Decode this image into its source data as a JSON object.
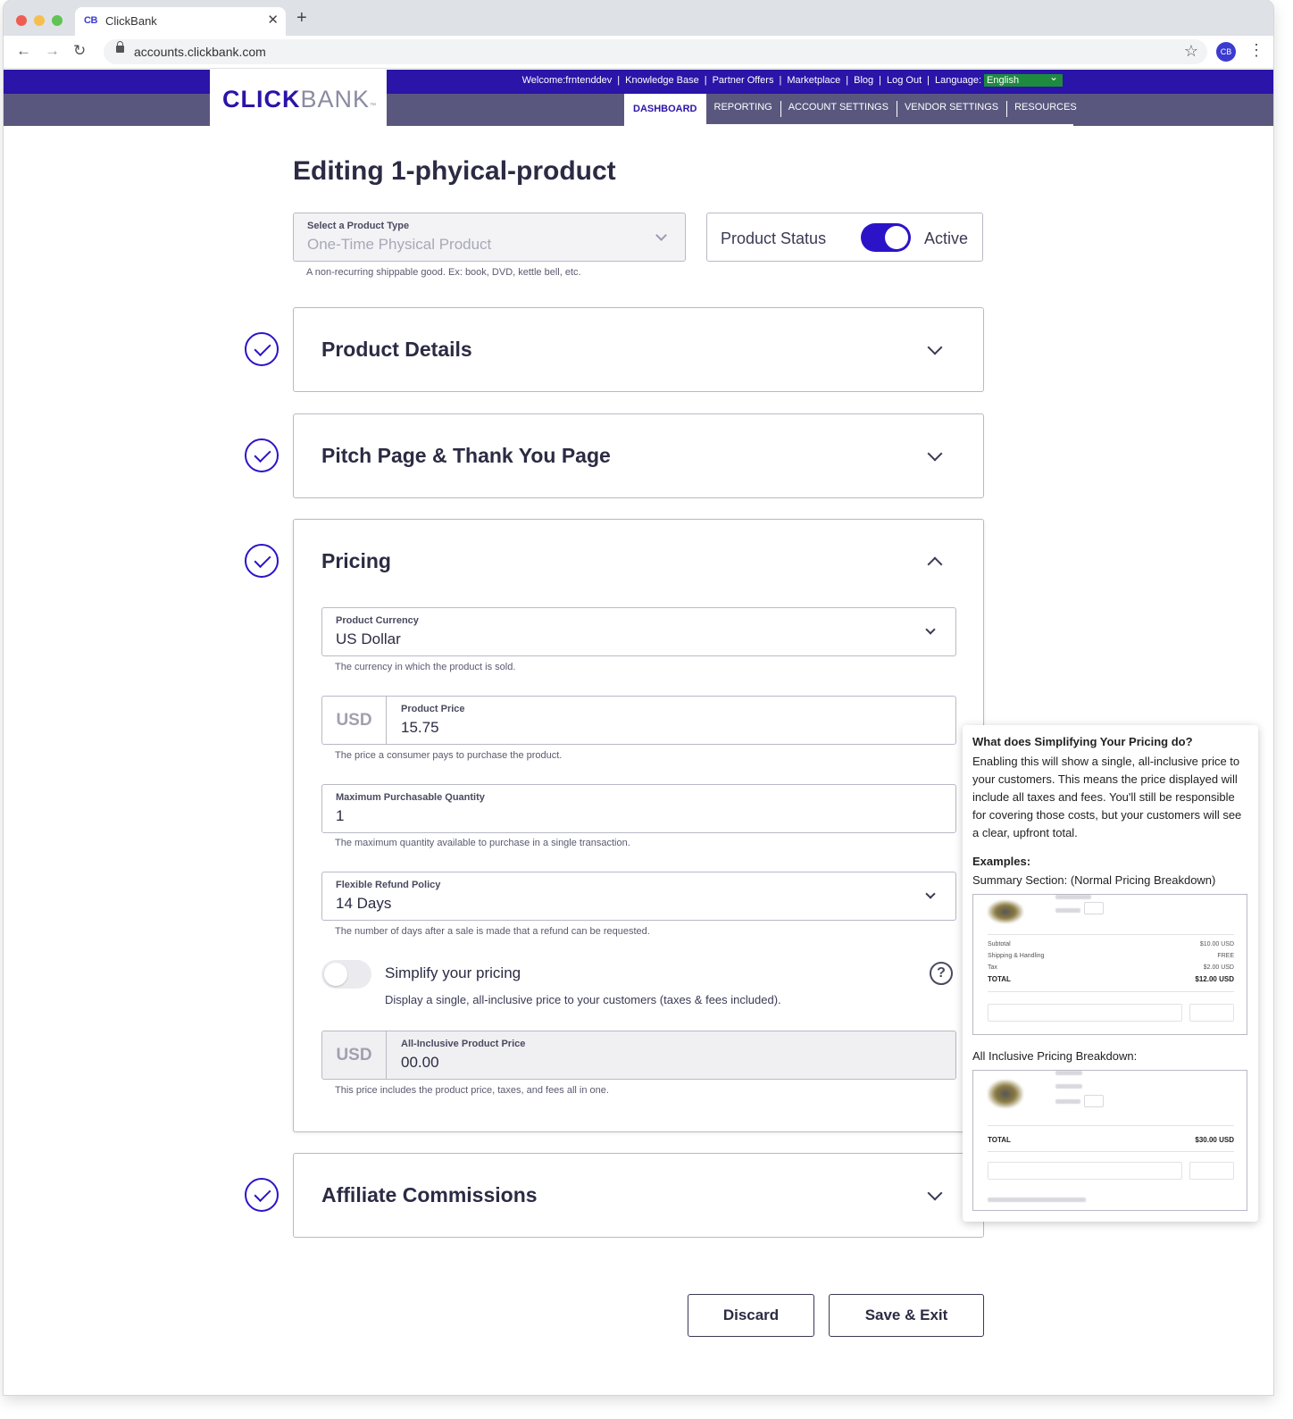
{
  "browser": {
    "tab_title": "ClickBank",
    "tab_favicon": "CB",
    "tab_close": "✕",
    "new_tab": "+",
    "url": "accounts.clickbank.com",
    "profile_initials": "CB",
    "icons": {
      "back": "←",
      "forward": "→",
      "reload": "↻",
      "bookmark": "☆",
      "menu": "⋮"
    }
  },
  "header": {
    "logo_click": "CLICK",
    "logo_bank": "BANK",
    "logo_tm": "™",
    "welcome": "Welcome:frntenddev",
    "links": [
      "Knowledge Base",
      "Partner Offers",
      "Marketplace",
      "Blog",
      "Log Out"
    ],
    "separator": "|",
    "language_label": "Language:",
    "language_value": "English",
    "nav": [
      "DASHBOARD",
      "REPORTING",
      "ACCOUNT SETTINGS",
      "VENDOR SETTINGS",
      "RESOURCES"
    ],
    "colors": {
      "topbar": "#2b14a8",
      "subbar": "#5a577f",
      "language": "#1e8a3e"
    }
  },
  "page": {
    "title": "Editing 1-phyical-product",
    "product_type": {
      "label": "Select a Product Type",
      "value": "One-Time Physical Product",
      "helper": "A non-recurring shippable good. Ex: book, DVD, kettle bell, etc."
    },
    "product_status": {
      "label": "Product Status",
      "value": "Active",
      "enabled": true
    }
  },
  "sections": {
    "product_details": "Product Details",
    "pitch_page": "Pitch Page & Thank You Page",
    "pricing": "Pricing",
    "affiliate": "Affiliate Commissions"
  },
  "pricing": {
    "currency": {
      "label": "Product Currency",
      "value": "US Dollar",
      "helper": "The currency in which the product is sold."
    },
    "price": {
      "prefix": "USD",
      "label": "Product Price",
      "value": "15.75",
      "helper": "The price a consumer pays to purchase the product."
    },
    "max_qty": {
      "label": "Maximum Purchasable Quantity",
      "value": "1",
      "helper": "The maximum quantity available to purchase in a single transaction."
    },
    "refund": {
      "label": "Flexible Refund Policy",
      "value": "14 Days",
      "helper": "The number of days after a sale is made that a refund can be requested."
    },
    "simplify": {
      "title": "Simplify your pricing",
      "description": "Display a single, all-inclusive price to your customers (taxes & fees included).",
      "help": "?",
      "enabled": false
    },
    "all_inclusive": {
      "prefix": "USD",
      "label": "All-Inclusive Product Price",
      "value": "00.00",
      "helper": "This price includes the product price, taxes, and fees all in one."
    }
  },
  "tooltip": {
    "title": "What does Simplifying Your Pricing do?",
    "body": "Enabling this will show a single, all-inclusive price to your customers. This means the price displayed will include all taxes and fees. You'll still be responsible for covering those costs, but your customers will see a clear, upfront total.",
    "examples_label": "Examples:",
    "summary_label": "Summary Section: (Normal Pricing Breakdown)",
    "normal_preview": {
      "rows": [
        {
          "label": "Subtotal",
          "value": "$10.00 USD"
        },
        {
          "label": "Shipping & Handling",
          "value": "FREE"
        },
        {
          "label": "Tax",
          "value": "$2.00 USD"
        }
      ],
      "total_label": "TOTAL",
      "total_value": "$12.00 USD"
    },
    "all_inclusive_label": "All Inclusive Pricing Breakdown:",
    "inclusive_preview": {
      "total_label": "TOTAL",
      "total_value": "$30.00 USD"
    }
  },
  "actions": {
    "discard": "Discard",
    "save": "Save & Exit"
  }
}
